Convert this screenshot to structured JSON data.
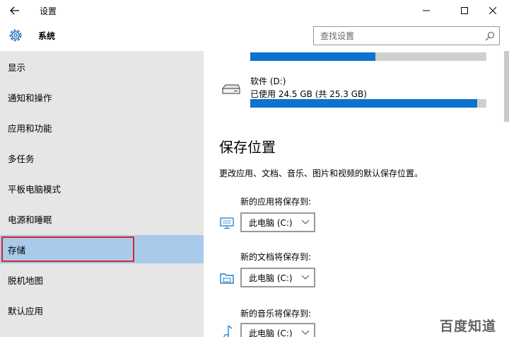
{
  "window": {
    "title": "设置",
    "back_icon": "back-arrow-icon",
    "minimize_icon": "minimize-icon",
    "maximize_icon": "maximize-icon",
    "close_icon": "close-icon"
  },
  "header": {
    "icon": "gear-icon",
    "title": "系统",
    "search_placeholder": "查找设置",
    "search_icon": "search-icon"
  },
  "sidebar": {
    "items": [
      {
        "label": "显示",
        "selected": false
      },
      {
        "label": "通知和操作",
        "selected": false
      },
      {
        "label": "应用和功能",
        "selected": false
      },
      {
        "label": "多任务",
        "selected": false
      },
      {
        "label": "平板电脑模式",
        "selected": false
      },
      {
        "label": "电源和睡眠",
        "selected": false
      },
      {
        "label": "存储",
        "selected": true
      },
      {
        "label": "脱机地图",
        "selected": false
      },
      {
        "label": "默认应用",
        "selected": false
      }
    ]
  },
  "storage": {
    "drives": [
      {
        "name": "",
        "usage": "",
        "used_fraction": 0.53
      },
      {
        "name": "软件 (D:)",
        "usage": "已使用 24.5 GB (共 25.3 GB)",
        "used_fraction": 0.96,
        "icon": "drive-icon"
      }
    ]
  },
  "save_locations": {
    "heading": "保存位置",
    "description": "更改应用、文档、音乐、图片和视频的默认保存位置。",
    "targets": [
      {
        "label": "新的应用将保存到:",
        "value": "此电脑 (C:)",
        "icon": "monitor-icon"
      },
      {
        "label": "新的文档将保存到:",
        "value": "此电脑 (C:)",
        "icon": "folder-icon"
      },
      {
        "label": "新的音乐将保存到:",
        "value": "此电脑 (C:)",
        "icon": "music-note-icon"
      }
    ]
  },
  "colors": {
    "accent": "#0a73d0",
    "selected_nav": "#a9caea",
    "sidebar_bg": "#e6e6e6",
    "highlight_box": "#d7262e"
  },
  "watermark": "百度知道"
}
